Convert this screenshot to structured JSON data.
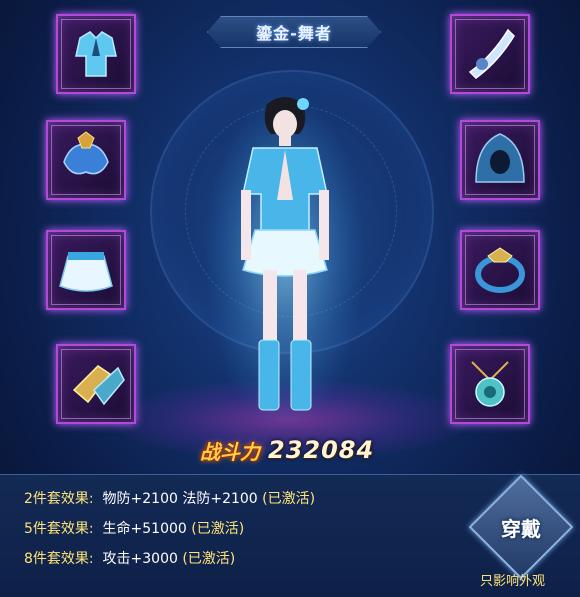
{
  "title": "鎏金-舞者",
  "equipment": {
    "left": [
      "top-icon",
      "shoulder-icon",
      "skirt-icon",
      "boots-icon"
    ],
    "right": [
      "weapon-icon",
      "hood-icon",
      "ring-icon",
      "amulet-icon"
    ]
  },
  "power": {
    "label": "战斗力",
    "value": "232084"
  },
  "set_effects": [
    {
      "key": "2件套效果:",
      "stats": "物防+2100  法防+2100",
      "status": "(已激活)"
    },
    {
      "key": "5件套效果:",
      "stats": "生命+51000",
      "status": "(已激活)"
    },
    {
      "key": "8件套效果:",
      "stats": "攻击+3000",
      "status": "(已激活)"
    }
  ],
  "wear_button": "穿戴",
  "note": "只影响外观",
  "colors": {
    "accent": "#ffe37a",
    "slot_border": "#b04ad8",
    "panel": "#132a55"
  }
}
